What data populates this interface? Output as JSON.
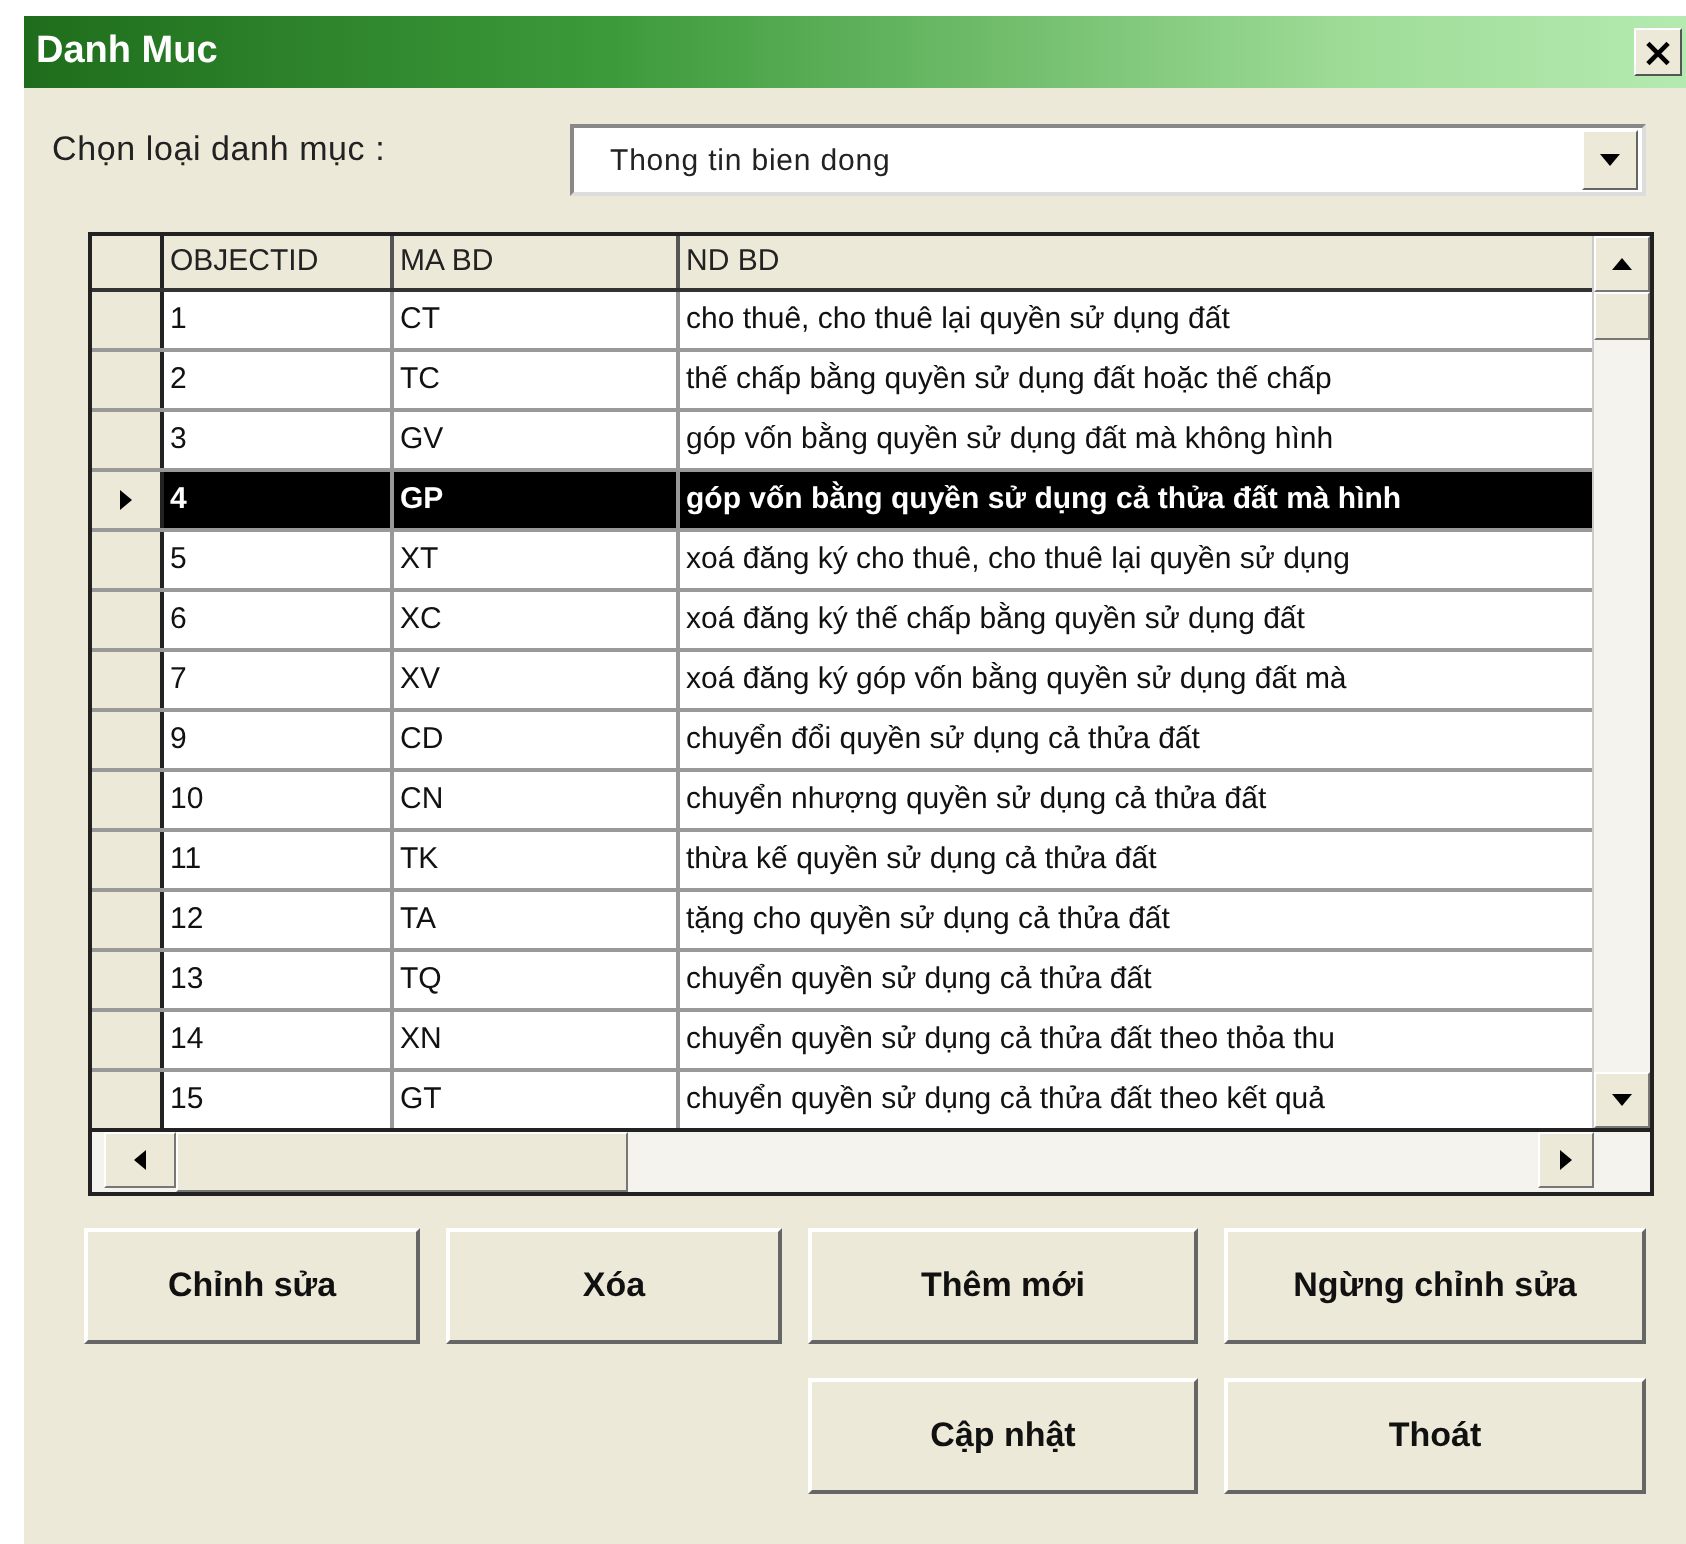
{
  "window": {
    "title": "Danh Muc",
    "close": "×"
  },
  "category": {
    "label": "Chọn loại danh mục :",
    "value": "Thong tin bien dong"
  },
  "table": {
    "columns": [
      "OBJECTID",
      "MA BD",
      "ND BD"
    ],
    "rows": [
      {
        "cells": [
          "1",
          "CT",
          "cho thuê, cho thuê lại quyền sử dụng đất"
        ],
        "selected": false
      },
      {
        "cells": [
          "2",
          "TC",
          "thế chấp bằng quyền sử dụng đất hoặc thế chấp"
        ],
        "selected": false
      },
      {
        "cells": [
          "3",
          "GV",
          "góp vốn bằng quyền sử dụng đất mà không hình"
        ],
        "selected": false
      },
      {
        "cells": [
          "4",
          "GP",
          "góp vốn bằng quyền sử dụng cả thửa đất mà hình"
        ],
        "selected": true
      },
      {
        "cells": [
          "5",
          "XT",
          "xoá đăng ký cho thuê, cho thuê lại quyền sử dụng"
        ],
        "selected": false
      },
      {
        "cells": [
          "6",
          "XC",
          "xoá đăng ký thế chấp bằng quyền sử dụng đất"
        ],
        "selected": false
      },
      {
        "cells": [
          "7",
          "XV",
          "xoá đăng ký góp vốn bằng quyền sử dụng đất mà"
        ],
        "selected": false
      },
      {
        "cells": [
          "9",
          "CD",
          "chuyển đổi quyền sử dụng cả thửa đất"
        ],
        "selected": false
      },
      {
        "cells": [
          "10",
          "CN",
          "chuyển nhượng quyền sử dụng cả thửa đất"
        ],
        "selected": false
      },
      {
        "cells": [
          "11",
          "TK",
          "thừa kế quyền sử dụng cả thửa đất"
        ],
        "selected": false
      },
      {
        "cells": [
          "12",
          "TA",
          "tặng cho quyền sử dụng cả thửa đất"
        ],
        "selected": false
      },
      {
        "cells": [
          "13",
          "TQ",
          "chuyển quyền sử dụng cả thửa đất"
        ],
        "selected": false
      },
      {
        "cells": [
          "14",
          "XN",
          "chuyển quyền sử dụng cả thửa đất theo thỏa thu"
        ],
        "selected": false
      },
      {
        "cells": [
          "15",
          "GT",
          "chuyển quyền sử dụng cả thửa đất theo kết quả"
        ],
        "selected": false
      }
    ]
  },
  "buttons": [
    [
      "Chỉnh sửa",
      "Xóa",
      "Thêm mới",
      "Ngừng chỉnh sửa"
    ],
    [
      "Cập nhật",
      "Thoát"
    ]
  ]
}
